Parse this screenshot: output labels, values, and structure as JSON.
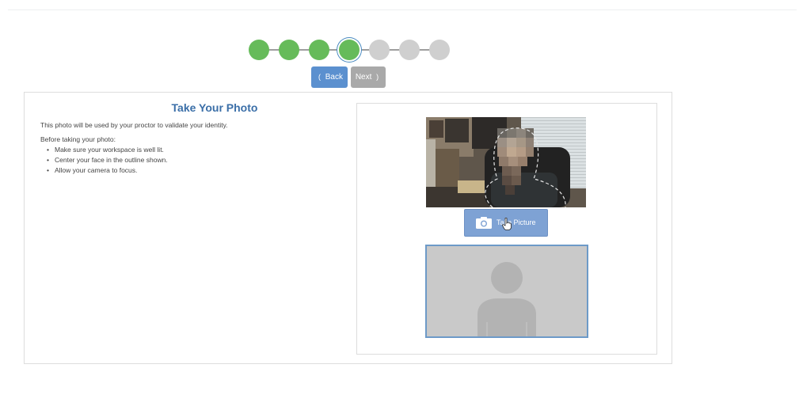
{
  "stepper": {
    "steps": [
      {
        "state": "done"
      },
      {
        "state": "done"
      },
      {
        "state": "done"
      },
      {
        "state": "current"
      },
      {
        "state": "todo"
      },
      {
        "state": "todo"
      },
      {
        "state": "todo"
      }
    ],
    "colors": {
      "done": "#66bb5a",
      "todo": "#cfcfcf",
      "current_ring": "#4a8bc0"
    }
  },
  "nav": {
    "back_chevron": "(",
    "back_label": "Back",
    "next_label": "Next",
    "next_chevron": ")",
    "back_color": "#5b90cf",
    "next_color": "#a9a9a9"
  },
  "main": {
    "title": "Take Your Photo",
    "description": "This photo will be used by your proctor to validate your identity.",
    "before_label": "Before taking your photo:",
    "tips": [
      "Make sure your workspace is well lit.",
      "Center your face in the outline shown.",
      "Allow your camera to focus."
    ]
  },
  "camera": {
    "take_picture_label": "Take Picture",
    "button_icon": "camera-icon",
    "placeholder_icon": "person-silhouette-icon",
    "accent": "#7ea2d4"
  }
}
